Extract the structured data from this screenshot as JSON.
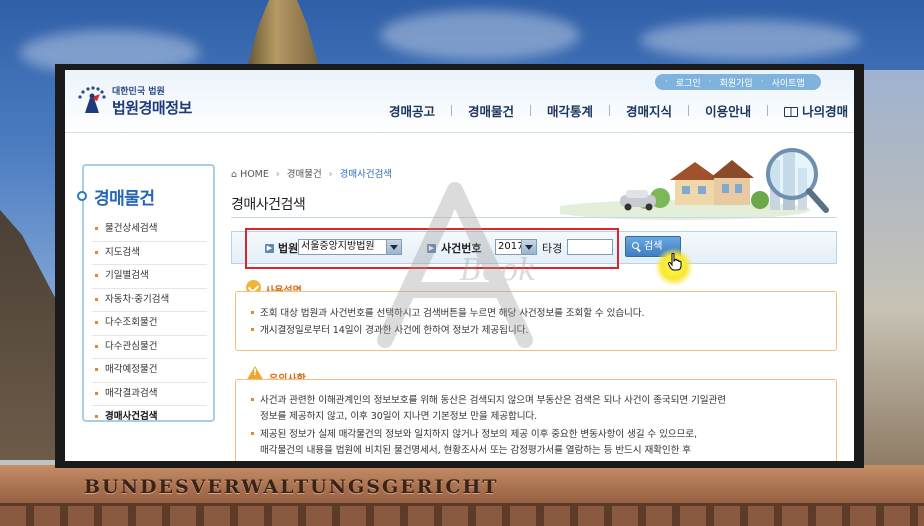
{
  "background": {
    "facade_text": "BUNDESVERWALTUNGSGERICHT"
  },
  "header": {
    "logo_sub": "대한민국 법원",
    "logo_main": "법원경매정보",
    "utility_links": [
      "로그인",
      "회원가입",
      "사이트맵"
    ],
    "nav": [
      "경매공고",
      "경매물건",
      "매각통계",
      "경매지식",
      "이용안내",
      "나의경매"
    ]
  },
  "sidebar": {
    "title": "경매물건",
    "items": [
      "물건상세검색",
      "지도검색",
      "기일별검색",
      "자동차·중기검색",
      "다수조회물건",
      "다수관심물건",
      "매각예정물건",
      "매각결과검색",
      "경매사건검색"
    ],
    "active_index": 8
  },
  "breadcrumb": {
    "home": "HOME",
    "level1": "경매물건",
    "current": "경매사건검색"
  },
  "page_title": "경매사건검색",
  "search": {
    "court_label": "법원",
    "court_value": "서울중앙지방법원",
    "case_label": "사건번호",
    "year_value": "2017",
    "case_type": "타경",
    "case_number_value": "",
    "button_label": "검색"
  },
  "usage": {
    "title": "사용설명",
    "lines": [
      "조회 대상 법원과 사건번호를 선택하시고 검색버튼을 누르면 해당 사건정보를 조회할 수 있습니다.",
      "개시결정일로부터 14일이 경과한 사건에 한하여 정보가 제공됩니다."
    ]
  },
  "caution": {
    "title": "유의사항",
    "lines": [
      "사건과 관련한 이해관계인의 정보보호를 위해 동산은 검색되지 않으며 부동산은 검색은 되나 사건이 종국되면 기일관련",
      "정보를 제공하지 않고, 이후 30일이 지나면 기본정보 만을 제공합니다.",
      "제공된 정보가 실제 매각물건의 정보와 일치하지 않거나 정보의 제공 이후 중요한 변동사항이 생길 수 있으므로,",
      "매각물건의 내용을 법원에 비치된 물건명세서, 현황조사서 또는 감정평가서를 열람하는 등 반드시 재확인한 후"
    ]
  },
  "watermark": "Book",
  "colors": {
    "accent": "#2366b3",
    "highlight": "#d9252c",
    "orange": "#d86b13"
  }
}
